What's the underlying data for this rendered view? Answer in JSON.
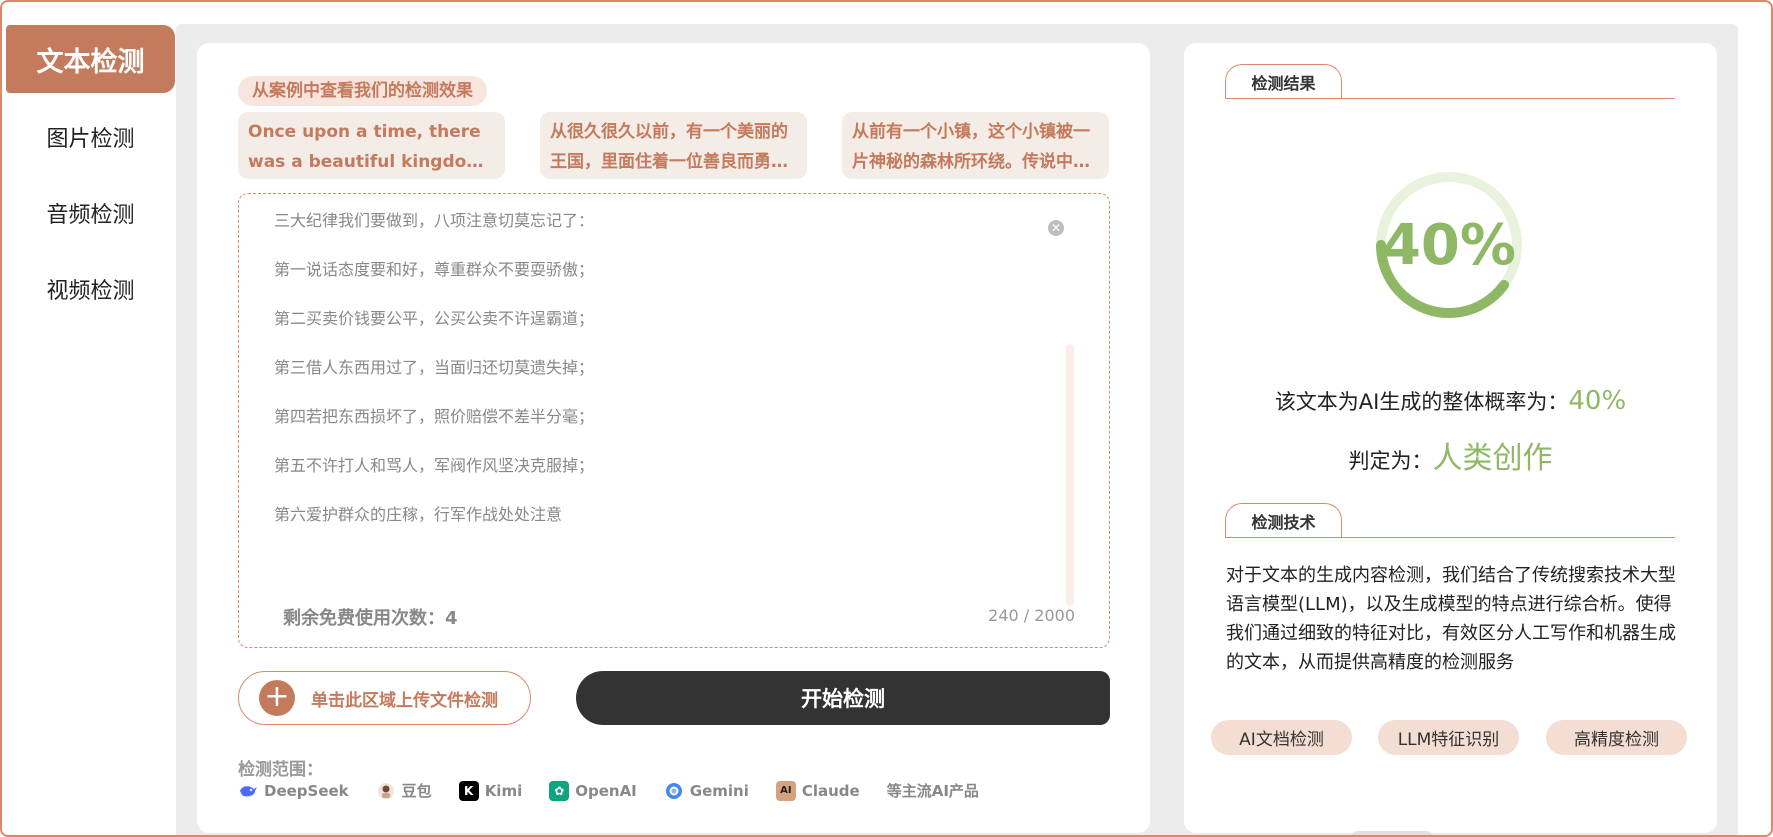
{
  "sidebar": {
    "items": [
      {
        "label": "文本检测",
        "active": true
      },
      {
        "label": "图片检测",
        "active": false
      },
      {
        "label": "音频检测",
        "active": false
      },
      {
        "label": "视频检测",
        "active": false
      }
    ]
  },
  "examples": {
    "title": "从案例中查看我们的检测效果",
    "items": [
      {
        "text": "Once upon a time, there was a beautiful kingdom where a..."
      },
      {
        "text": "从很久很久以前，有一个美丽的王国，里面住着一位善良而勇敢的..."
      },
      {
        "text": "从前有一个小镇，这个小镇被一片神秘的森林所环绕。传说中，森..."
      }
    ]
  },
  "input": {
    "lines": [
      "三大纪律我们要做到，八项注意切莫忘记了：",
      "第一说话态度要和好，尊重群众不要耍骄傲；",
      "第二买卖价钱要公平，公买公卖不许逞霸道；",
      "第三借人东西用过了，当面归还切莫遗失掉；",
      "第四若把东西损坏了，照价赔偿不差半分毫；",
      "第五不许打人和骂人，军阀作风坚决克服掉；",
      "第六爱护群众的庄稼，行军作战处处注意"
    ],
    "remaining_label": "剩余免费使用次数：4",
    "char_count": "240 / 2000"
  },
  "actions": {
    "upload_label": "单击此区域上传文件检测",
    "start_label": "开始检测"
  },
  "scope": {
    "label": "检测范围：",
    "models": [
      {
        "name": "DeepSeek",
        "icon": "deepseek-icon",
        "color": "#4d6bfe"
      },
      {
        "name": "豆包",
        "icon": "doubao-icon",
        "color": "#7a5c4a"
      },
      {
        "name": "Kimi",
        "icon": "kimi-icon",
        "color": "#000000"
      },
      {
        "name": "OpenAI",
        "icon": "openai-icon",
        "color": "#10a37f"
      },
      {
        "name": "Gemini",
        "icon": "gemini-icon",
        "color": "#4285f4"
      },
      {
        "name": "Claude",
        "icon": "claude-icon",
        "color": "#d4a27f"
      }
    ],
    "etc": "等主流AI产品"
  },
  "result": {
    "section_title": "检测结果",
    "gauge_value": "40%",
    "gauge_fraction": 0.4,
    "prob_label": "该文本为AI生成的整体概率为：",
    "prob_value": "40%",
    "verdict_label": "判定为：",
    "verdict_value": "人类创作",
    "accent_color": "#8fb866"
  },
  "tech": {
    "section_title": "检测技术",
    "description": "对于文本的生成内容检测，我们结合了传统搜索技术大型语言模型(LLM)，以及生成模型的特点进行综合析。使得我们通过细致的特征对比，有效区分人工写作和机器生成的文本，从而提供高精度的检测服务",
    "tags": [
      "AI文档检测",
      "LLM特征识别",
      "高精度检测"
    ]
  }
}
